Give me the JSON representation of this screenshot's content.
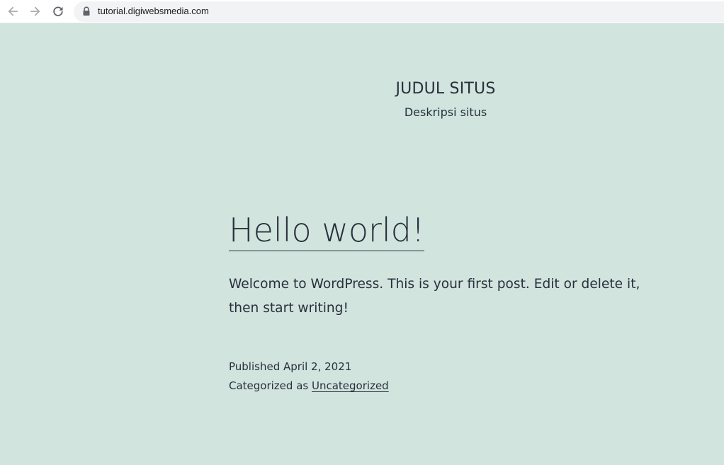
{
  "browser": {
    "url": "tutorial.digiwebsmedia.com",
    "icons": {
      "back": "arrow-left-icon",
      "forward": "arrow-right-icon",
      "reload": "reload-icon",
      "lock": "lock-icon"
    }
  },
  "site": {
    "title": "JUDUL SITUS",
    "description": "Deskripsi situs"
  },
  "post": {
    "title": "Hello world!",
    "body": "Welcome to WordPress. This is your first post. Edit or delete it, then start writing!",
    "published_prefix": "Published",
    "published_date": "April 2, 2021",
    "category_prefix": "Categorized as",
    "category": "Uncategorized"
  },
  "colors": {
    "background": "#d1e4dd",
    "text": "#28303d"
  }
}
